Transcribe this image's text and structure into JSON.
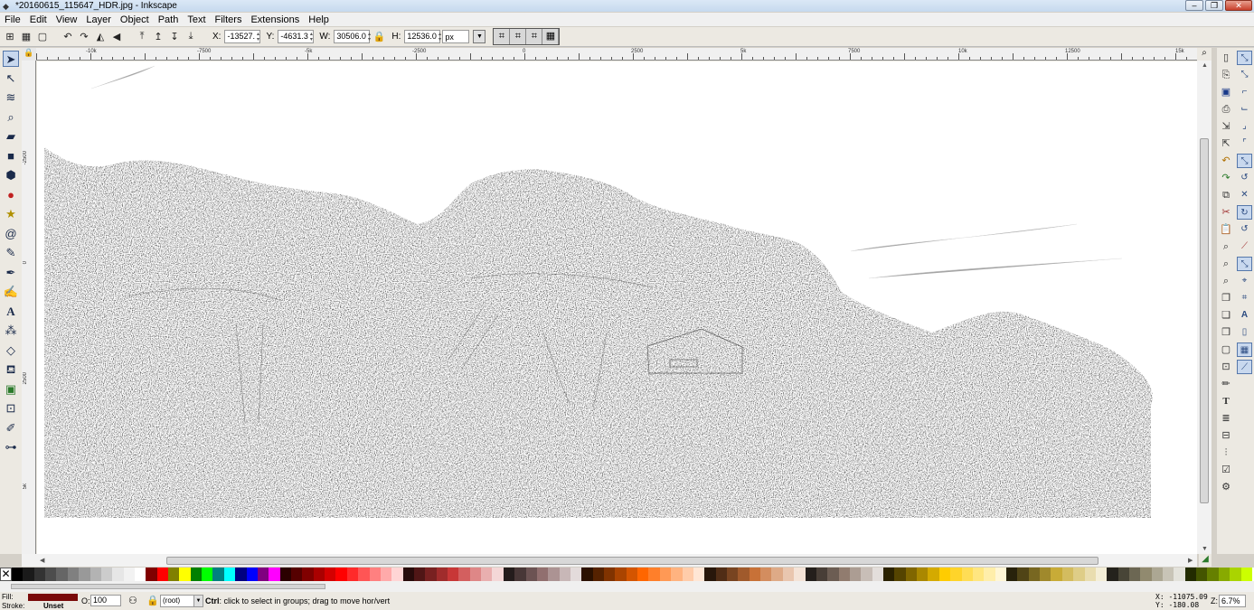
{
  "window": {
    "title": "*20160615_115647_HDR.jpg - Inkscape",
    "controls": [
      "–",
      "❐",
      "✕"
    ]
  },
  "menu": [
    "File",
    "Edit",
    "View",
    "Layer",
    "Object",
    "Path",
    "Text",
    "Filters",
    "Extensions",
    "Help"
  ],
  "toolbar": {
    "x_label": "X:",
    "x_value": "-13527.",
    "y_label": "Y:",
    "y_value": "-4631.3",
    "w_label": "W:",
    "w_value": "30506.0",
    "h_label": "H:",
    "h_value": "12536.0",
    "unit": "px"
  },
  "ruler": {
    "top_ticks": [
      "-10k",
      "-7500",
      "-5k",
      "-2500",
      "0",
      "2500",
      "5k",
      "7500",
      "10k",
      "12500",
      "15k"
    ],
    "left_ticks": [
      "-2500",
      "0",
      "2500",
      "5k"
    ]
  },
  "status": {
    "fill_label": "Fill:",
    "stroke_label": "Stroke:",
    "stroke_value": "Unset",
    "fill_color": "#7a0a0a",
    "opacity_label": "O:",
    "opacity_value": "100",
    "layer": "(root)",
    "message_key": "Ctrl",
    "message_text": ": click to select in groups; drag to move hor/vert",
    "x_coord": "X: -11075.09",
    "y_coord": "Y:   -180.08",
    "zoom_label": "Z:",
    "zoom_value": "6.7%"
  },
  "tools": [
    "selector-icon",
    "node-icon",
    "tweak-icon",
    "zoom-icon",
    "measure-icon",
    "rect-icon",
    "3dbox-icon",
    "ellipse-icon",
    "star-icon",
    "spiral-icon",
    "pencil-icon",
    "pen-icon",
    "calligraphy-icon",
    "text-icon",
    "spray-icon",
    "eraser-icon",
    "paint-bucket-icon",
    "gradient-icon",
    "mesh-icon",
    "dropper-icon",
    "connector-icon"
  ],
  "palette": [
    "#000000",
    "#1a1a1a",
    "#333333",
    "#4d4d4d",
    "#666666",
    "#808080",
    "#999999",
    "#b3b3b3",
    "#cccccc",
    "#e6e6e6",
    "#f2f2f2",
    "#ffffff",
    "#800000",
    "#ff0000",
    "#808000",
    "#ffff00",
    "#008000",
    "#00ff00",
    "#008080",
    "#00ffff",
    "#000080",
    "#0000ff",
    "#800080",
    "#ff00ff",
    "#2b0000",
    "#550000",
    "#800000",
    "#aa0000",
    "#d40000",
    "#ff0000",
    "#ff2a2a",
    "#ff5555",
    "#ff8080",
    "#ffaaaa",
    "#ffd5d5",
    "#280b0b",
    "#501616",
    "#782121",
    "#a02c2c",
    "#c83737",
    "#d35f5f",
    "#de8787",
    "#e9afaf",
    "#f4d7d7",
    "#241c1c",
    "#483737",
    "#6c5353",
    "#916f6f",
    "#ac9393",
    "#c8b7b7",
    "#e3dbdb",
    "#2b1100",
    "#552200",
    "#803300",
    "#aa4400",
    "#d45500",
    "#ff6600",
    "#ff7f2a",
    "#ff9955",
    "#ffb380",
    "#ffccaa",
    "#ffe6d5",
    "#28170b",
    "#502d16",
    "#784421",
    "#a05a2c",
    "#c87137",
    "#d38d5f",
    "#deaa87",
    "#e9c6af",
    "#f4e3d7",
    "#241f1c",
    "#483e37",
    "#6c5d53",
    "#917c6f",
    "#ac9d93",
    "#c8beb7",
    "#e3dedb",
    "#2b2200",
    "#554400",
    "#806600",
    "#aa8800",
    "#d4aa00",
    "#ffcc00",
    "#ffd42a",
    "#ffdd55",
    "#ffe680",
    "#ffeeaa",
    "#fff6d5",
    "#28220b",
    "#504416",
    "#786721",
    "#a0892c",
    "#c8ab37",
    "#d3bc5f",
    "#decd87",
    "#e9ddaf",
    "#f4eed7",
    "#24221c",
    "#484537",
    "#6c6753",
    "#918a6f",
    "#aca793",
    "#c8c4b7",
    "#e3e2db",
    "#222b00",
    "#445500",
    "#668000",
    "#88aa00",
    "#aad400",
    "#ccff00"
  ]
}
